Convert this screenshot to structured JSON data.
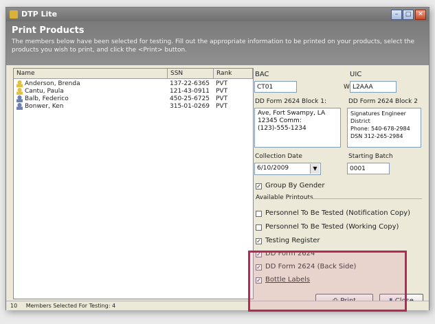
{
  "window": {
    "title": "DTP Lite",
    "min_label": "–",
    "max_label": "□",
    "close_label": "✕"
  },
  "header": {
    "title": "Print Products",
    "description": "The members below have been selected for testing.  Fill out the appropriate information to be printed on your products, select the products you wish to print, and click the <Print> button."
  },
  "members": {
    "columns": [
      "Name",
      "SSN",
      "Rank"
    ],
    "rows": [
      {
        "name": "Anderson, Brenda",
        "ssn": "137-22-6365",
        "rank": "PVT",
        "gender": "female"
      },
      {
        "name": "Cantu, Paula",
        "ssn": "121-43-0911",
        "rank": "PVT",
        "gender": "female"
      },
      {
        "name": "Balb, Federico",
        "ssn": "450-25-6725",
        "rank": "PVT",
        "gender": "male"
      },
      {
        "name": "Bonwer, Ken",
        "ssn": "315-01-0269",
        "rank": "PVT",
        "gender": "male"
      }
    ]
  },
  "form": {
    "bac_label": "BAC",
    "bac_value": "CT01",
    "uic_label": "UIC",
    "uic_prefix": "W",
    "uic_value": "L2AAA",
    "block1_label": "DD Form 2624 Block 1:",
    "block1_lines": [
      "Ave, Fort Swampy, LA",
      "12345 Comm:",
      "(123)-555-1234"
    ],
    "block2_label": "DD Form 2624 Block 2",
    "block2_lines": [
      "Signatures Engineer",
      "District",
      "Phone: 540-678-2984",
      "DSN 312-265-2984"
    ],
    "collection_date_label": "Collection Date",
    "collection_date_value": "6/10/2009",
    "starting_batch_label": "Starting Batch",
    "starting_batch_value": "0001",
    "group_by_gender_label": "Group By Gender",
    "group_by_gender_checked": true
  },
  "printouts": {
    "group_label": "Available Printouts",
    "items": [
      {
        "label": "Personnel To Be Tested (Notification Copy)",
        "checked": false
      },
      {
        "label": "Personnel To Be Tested (Working Copy)",
        "checked": false
      },
      {
        "label": "Testing Register",
        "checked": true
      },
      {
        "label": "DD Form 2624",
        "checked": true
      },
      {
        "label": "DD Form 2624 (Back Side)",
        "checked": true
      },
      {
        "label": "Bottle Labels",
        "checked": true
      }
    ]
  },
  "buttons": {
    "print": "Print",
    "close": "Close"
  },
  "status": {
    "prefix": "10",
    "text": "Members Selected For Testing: 4"
  },
  "colors": {
    "highlight": "#b42a57",
    "header_bg": "#808080"
  }
}
